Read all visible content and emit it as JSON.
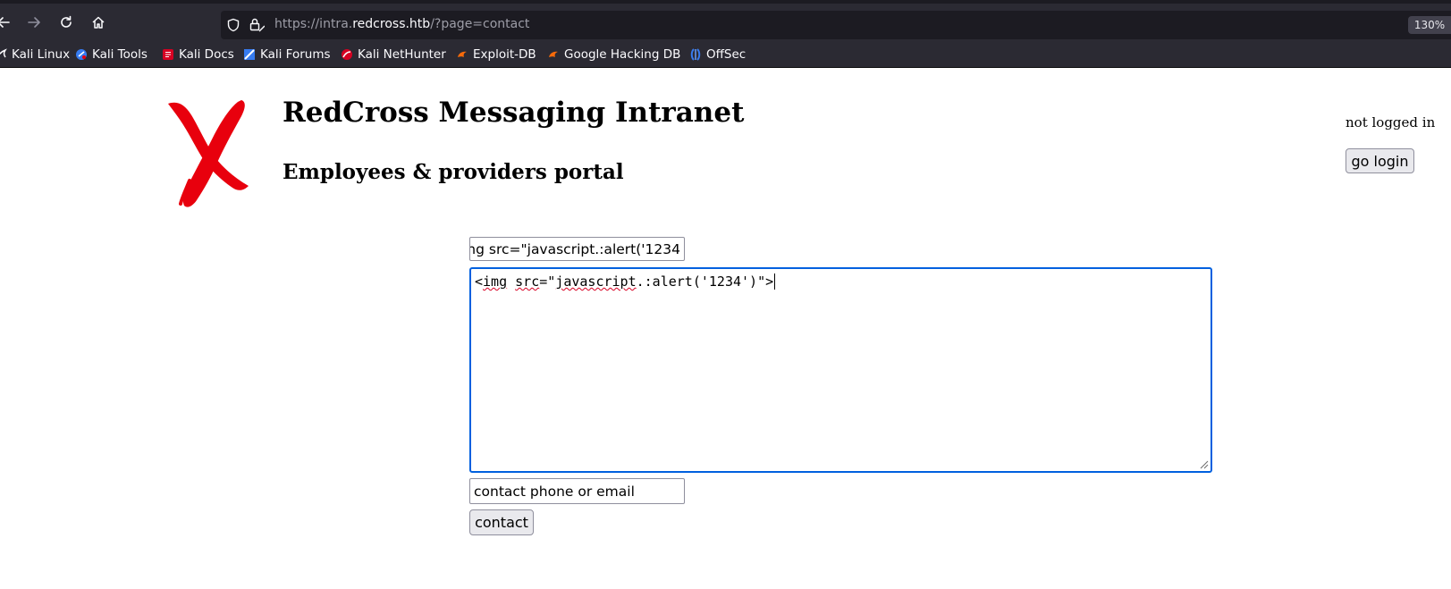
{
  "browser": {
    "url_prefix": "https://intra.",
    "url_host": "redcross.htb",
    "url_path": "/?page=contact",
    "zoom": "130%"
  },
  "bookmarks": [
    {
      "label": "Kali Linux",
      "icon": "kali-dragon-icon",
      "color": "#ffffff"
    },
    {
      "label": "Kali Tools",
      "icon": "kali-tools-icon",
      "color": "#367bf0"
    },
    {
      "label": "Kali Docs",
      "icon": "kali-docs-icon",
      "color": "#d70022"
    },
    {
      "label": "Kali Forums",
      "icon": "kali-forums-icon",
      "color": "#367bf0"
    },
    {
      "label": "Kali NetHunter",
      "icon": "kali-nethunter-icon",
      "color": "#d70022"
    },
    {
      "label": "Exploit-DB",
      "icon": "exploit-db-icon",
      "color": "#f66a0a"
    },
    {
      "label": "Google Hacking DB",
      "icon": "ghdb-icon",
      "color": "#f66a0a"
    },
    {
      "label": "OffSec",
      "icon": "offsec-icon",
      "color": "#367bf0"
    }
  ],
  "header": {
    "title": "RedCross Messaging Intranet",
    "subtitle": "Employees & providers portal",
    "logo_color": "#e8000d"
  },
  "auth": {
    "status": "not logged in",
    "login_button": "go login"
  },
  "form": {
    "subject_value": "ng src=\"javascript.:alert('1234",
    "message_prefix": "<",
    "message_word1": "img",
    "message_space": " ",
    "message_word2": "src",
    "message_eq": "=\"",
    "message_word3": "javascript",
    "message_rest": ".:alert('1234')\">",
    "contact_placeholder": "contact phone or email",
    "submit_label": "contact"
  }
}
